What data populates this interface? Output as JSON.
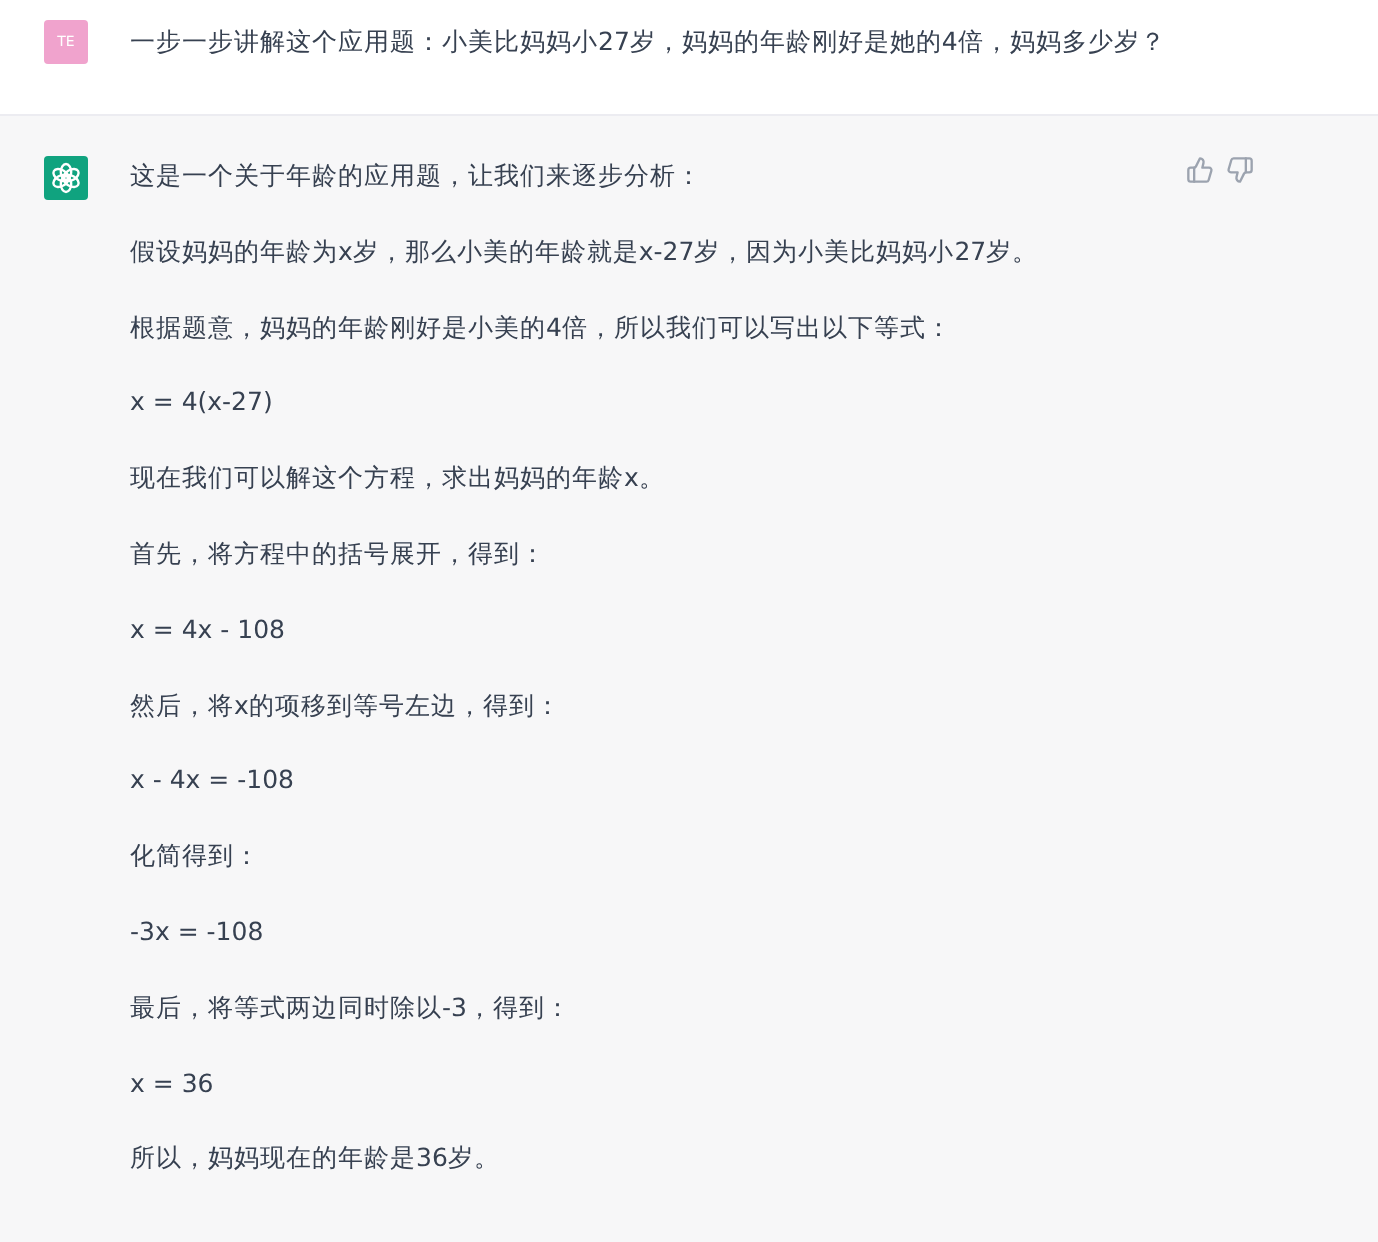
{
  "user_message": {
    "avatar": "TE",
    "text": "一步一步讲解这个应用题：小美比妈妈小27岁，妈妈的年龄刚好是她的4倍，妈妈多少岁？"
  },
  "assistant_message": {
    "paragraphs": [
      "这是一个关于年龄的应用题，让我们来逐步分析：",
      "假设妈妈的年龄为x岁，那么小美的年龄就是x-27岁，因为小美比妈妈小27岁。",
      "根据题意，妈妈的年龄刚好是小美的4倍，所以我们可以写出以下等式：",
      "x = 4(x-27)",
      "现在我们可以解这个方程，求出妈妈的年龄x。",
      "首先，将方程中的括号展开，得到：",
      "x = 4x - 108",
      "然后，将x的项移到等号左边，得到：",
      "x - 4x = -108",
      "化简得到：",
      "-3x = -108",
      "最后，将等式两边同时除以-3，得到：",
      "x = 36",
      "所以，妈妈现在的年龄是36岁。"
    ]
  }
}
